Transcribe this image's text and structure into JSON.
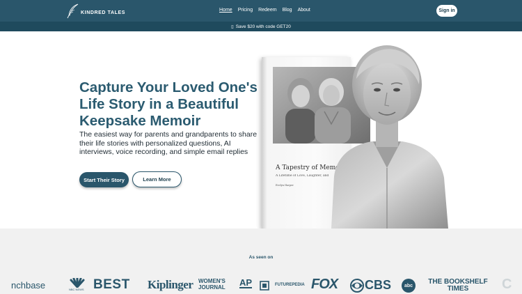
{
  "brand": {
    "name": "KINDRED TALES",
    "icon": "quill-icon"
  },
  "nav": {
    "links": [
      {
        "label": "Home",
        "active": true
      },
      {
        "label": "Pricing"
      },
      {
        "label": "Redeem"
      },
      {
        "label": "Blog"
      },
      {
        "label": "About"
      }
    ],
    "signin_label": "Sign in"
  },
  "promo": {
    "icon": "gift-icon",
    "text": "Save $20 with code GET20"
  },
  "hero": {
    "headline": "Capture Your Loved One's Life Story in a Beautiful Keepsake Memoir",
    "subtext": "The easiest way for parents and grandparents to share their life stories with personalized questions, AI interviews, voice recording,  and simple email replies",
    "primary_cta": "Start Their Story",
    "secondary_cta": "Learn More",
    "book": {
      "title": "A Tapestry of Memories",
      "subtitle": "A Lifetime of Love, Laughter, and",
      "author": "Evelyn Harper"
    }
  },
  "press": {
    "title": "As seen on",
    "logos": [
      "nchbase",
      "NBC NEWS",
      "BEST",
      "Kiplinger",
      "WOMEN'S JOURNAL",
      "AP",
      "FUTUREPEDIA",
      "FOX",
      "CBS",
      "abc",
      "THE BOOKSHELF TIMES",
      "C"
    ]
  },
  "colors": {
    "primary": "#2a566b",
    "promo_bg": "#1f4a5d",
    "press_bg": "#f1f1f1",
    "accent_text": "#2b5b70"
  }
}
